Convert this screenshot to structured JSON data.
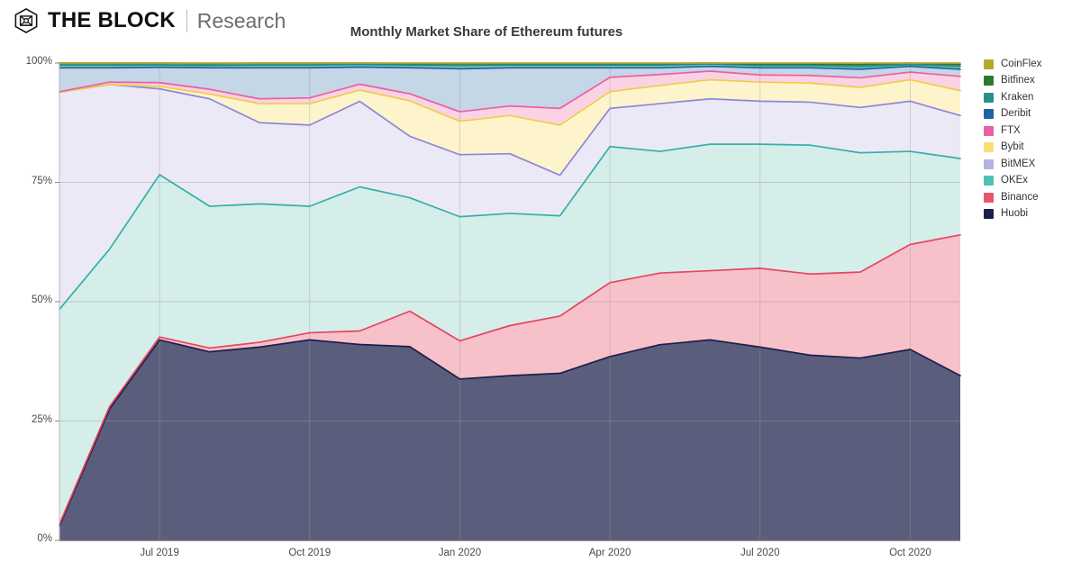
{
  "brand": {
    "logo_icon": "the-block-cube-icon",
    "name": "THE BLOCK",
    "subtitle": "Research"
  },
  "chart_data": {
    "type": "area",
    "stacked": true,
    "normalized": true,
    "title": "Monthly Market Share of Ethereum futures",
    "xlabel": "",
    "ylabel": "",
    "ylim": [
      0,
      100
    ],
    "ytick_labels": [
      "0%",
      "25%",
      "50%",
      "75%",
      "100%"
    ],
    "ytick_values": [
      0,
      25,
      50,
      75,
      100
    ],
    "xtick_labels": [
      "Jul 2019",
      "Oct 2019",
      "Jan 2020",
      "Apr 2020",
      "Jul 2020",
      "Oct 2020"
    ],
    "grid": true,
    "legend_position": "right",
    "x": [
      "May 2019",
      "Jun 2019",
      "Jul 2019",
      "Aug 2019",
      "Sep 2019",
      "Oct 2019",
      "Nov 2019",
      "Dec 2019",
      "Jan 2020",
      "Feb 2020",
      "Mar 2020",
      "Apr 2020",
      "May 2020",
      "Jun 2020",
      "Jul 2020",
      "Aug 2020",
      "Sep 2020",
      "Oct 2020",
      "Nov 2020"
    ],
    "series": [
      {
        "name": "Huobi",
        "color": "#1c1f4b",
        "fill": "#1c1f4b",
        "values": [
          3.0,
          27.5,
          42.0,
          39.5,
          40.5,
          42.0,
          43.5,
          41.0,
          33.8,
          34.5,
          35.0,
          38.5,
          41.0,
          42.0,
          40.5,
          38.8,
          38.2,
          40.0,
          34.5
        ]
      },
      {
        "name": "Binance",
        "color": "#e8445f",
        "fill": "#f4a9b4",
        "values": [
          0.4,
          0.5,
          0.6,
          0.8,
          1.0,
          1.5,
          3.0,
          7.5,
          8.0,
          10.5,
          12.0,
          15.5,
          15.0,
          14.5,
          16.5,
          17.0,
          18.0,
          22.0,
          29.5
        ]
      },
      {
        "name": "OKEx",
        "color": "#35b0a7",
        "fill": "#c5e8e2",
        "values": [
          45.0,
          33.0,
          34.0,
          29.7,
          29.0,
          26.5,
          32.0,
          24.0,
          26.0,
          23.5,
          21.0,
          28.5,
          25.5,
          26.5,
          26.0,
          27.0,
          25.0,
          19.5,
          16.0
        ]
      },
      {
        "name": "BitMEX",
        "color": "#8c87d8",
        "fill": "#e4e1f4",
        "values": [
          45.5,
          34.5,
          18.0,
          22.5,
          17.0,
          17.0,
          19.0,
          13.0,
          13.0,
          12.5,
          8.5,
          8.0,
          10.0,
          9.5,
          9.0,
          9.0,
          9.5,
          10.5,
          9.0
        ]
      },
      {
        "name": "Bybit",
        "color": "#f0cc4a",
        "fill": "#fcf0b8",
        "values": [
          0.0,
          0.0,
          0.5,
          1.0,
          4.0,
          4.5,
          2.5,
          7.5,
          7.0,
          8.0,
          10.5,
          3.5,
          3.8,
          4.0,
          4.0,
          4.0,
          4.2,
          4.5,
          5.2
        ]
      },
      {
        "name": "FTX",
        "color": "#ec5fa0",
        "fill": "#f7c2da",
        "values": [
          0.1,
          0.5,
          0.8,
          1.0,
          1.0,
          1.2,
          1.3,
          1.5,
          2.0,
          2.0,
          3.5,
          3.0,
          2.3,
          1.8,
          1.5,
          1.6,
          2.0,
          1.6,
          3.0
        ]
      },
      {
        "name": "Deribit",
        "color": "#1f62a8",
        "fill": "#aec6dc",
        "values": [
          5.0,
          3.0,
          3.2,
          4.5,
          6.5,
          6.3,
          3.8,
          5.5,
          9.0,
          8.0,
          8.5,
          2.0,
          1.4,
          1.0,
          1.5,
          1.6,
          1.8,
          1.2,
          1.5
        ]
      },
      {
        "name": "Kraken",
        "color": "#1f8f81",
        "fill": "#4aa79a",
        "values": [
          0.6,
          0.6,
          0.5,
          0.5,
          0.6,
          0.6,
          0.6,
          0.6,
          0.7,
          0.6,
          0.6,
          0.6,
          0.6,
          0.5,
          0.5,
          0.5,
          0.6,
          0.4,
          0.6
        ]
      },
      {
        "name": "Bitfinex",
        "color": "#2d7a2d",
        "fill": "#3b8c33",
        "values": [
          0.4,
          0.4,
          0.4,
          0.4,
          0.4,
          0.4,
          0.3,
          0.3,
          0.4,
          0.3,
          0.3,
          0.3,
          0.3,
          0.2,
          0.3,
          0.3,
          0.4,
          0.3,
          0.4
        ]
      },
      {
        "name": "CoinFlex",
        "color": "#b5ab2e",
        "fill": "#c9bf4b",
        "values": [
          0.0,
          0.0,
          0.0,
          0.1,
          0.0,
          0.0,
          0.0,
          0.1,
          0.1,
          0.1,
          0.1,
          0.1,
          0.1,
          0.0,
          0.2,
          0.2,
          0.3,
          0.0,
          0.3
        ]
      }
    ],
    "legend": [
      {
        "label": "CoinFlex",
        "color": "#b5ab2e"
      },
      {
        "label": "Bitfinex",
        "color": "#2d7a2d"
      },
      {
        "label": "Kraken",
        "color": "#2a9085"
      },
      {
        "label": "Deribit",
        "color": "#1f62a8"
      },
      {
        "label": "FTX",
        "color": "#ec5fa0"
      },
      {
        "label": "Bybit",
        "color": "#f7df73"
      },
      {
        "label": "BitMEX",
        "color": "#b6b2e3"
      },
      {
        "label": "OKEx",
        "color": "#4dc2b4"
      },
      {
        "label": "Binance",
        "color": "#e8566d"
      },
      {
        "label": "Huobi",
        "color": "#1c1f4b"
      }
    ]
  }
}
